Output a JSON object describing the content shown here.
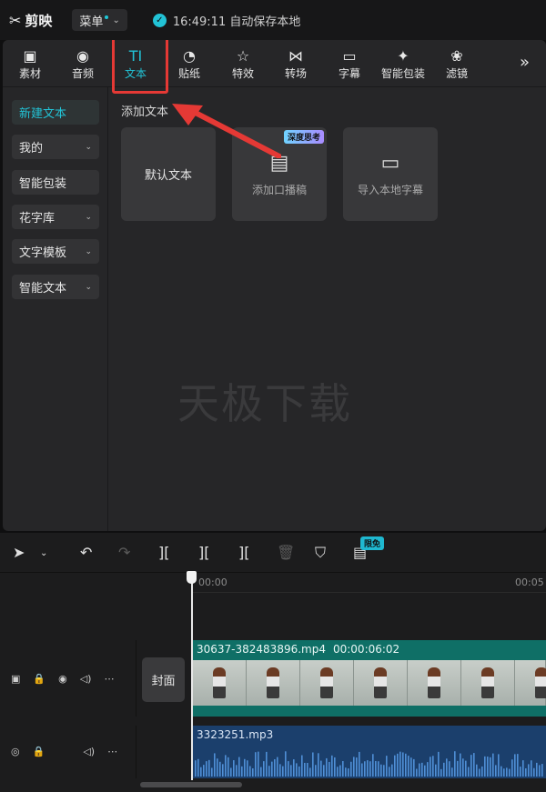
{
  "titlebar": {
    "app_name": "剪映",
    "menu_label": "菜单",
    "save_status": "16:49:11 自动保存本地"
  },
  "toolbar": {
    "tabs": [
      {
        "label": "素材",
        "icon": "media-icon"
      },
      {
        "label": "音频",
        "icon": "audio-icon"
      },
      {
        "label": "文本",
        "icon": "text-icon",
        "active": true
      },
      {
        "label": "贴纸",
        "icon": "sticker-icon"
      },
      {
        "label": "特效",
        "icon": "effects-icon"
      },
      {
        "label": "转场",
        "icon": "transition-icon"
      },
      {
        "label": "字幕",
        "icon": "subtitle-icon"
      },
      {
        "label": "智能包装",
        "icon": "smart-pack-icon"
      },
      {
        "label": "滤镜",
        "icon": "filter-icon"
      }
    ],
    "more": "»"
  },
  "sidebar": {
    "items": [
      {
        "label": "新建文本",
        "active": true
      },
      {
        "label": "我的",
        "dropdown": true
      },
      {
        "label": "智能包装"
      },
      {
        "label": "花字库",
        "dropdown": true
      },
      {
        "label": "文字模板",
        "dropdown": true
      },
      {
        "label": "智能文本",
        "dropdown": true
      }
    ]
  },
  "content": {
    "section_title": "添加文本",
    "cards": [
      {
        "label": "默认文本"
      },
      {
        "label": "添加口播稿",
        "badge": "深度思考",
        "icon": "script-icon"
      },
      {
        "label": "导入本地字幕",
        "icon": "folder-icon"
      }
    ],
    "watermark": "天极下载"
  },
  "timeline": {
    "tools_badge": "限免",
    "ruler": {
      "start": "00:00",
      "end": "00:05"
    },
    "cover_label": "封面",
    "video_clip": {
      "name": "30637-382483896.mp4",
      "duration": "00:00:06:02"
    },
    "audio_clip": {
      "name": "3323251.mp3"
    }
  },
  "colors": {
    "accent": "#22c3d6",
    "highlight": "#e53935"
  }
}
